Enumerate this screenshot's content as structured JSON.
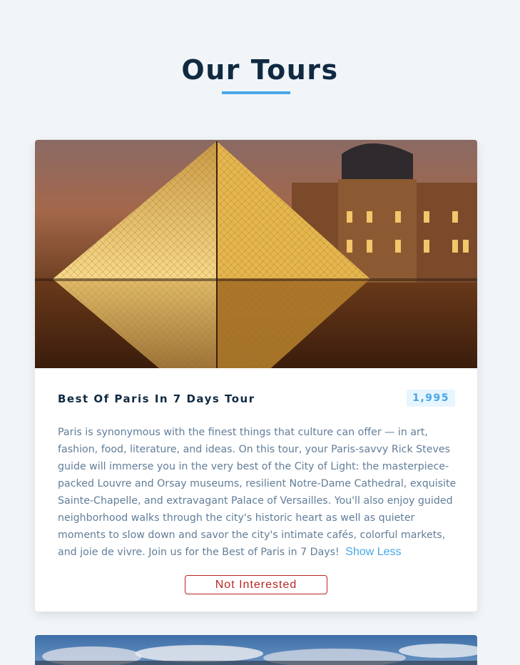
{
  "section": {
    "title": "Our Tours"
  },
  "tours": [
    {
      "name": "Best Of Paris In 7 Days Tour",
      "price": "1,995",
      "info": "Paris is synonymous with the finest things that culture can offer — in art, fashion, food, literature, and ideas. On this tour, your Paris-savvy Rick Steves guide will immerse you in the very best of the City of Light: the masterpiece-packed Louvre and Orsay museums, resilient Notre-Dame Cathedral, exquisite Sainte-Chapelle, and extravagant Palace of Versailles. You'll also enjoy guided neighborhood walks through the city's historic heart as well as quieter moments to slow down and savor the city's intimate cafés, colorful markets, and joie de vivre. Join us for the Best of Paris in 7 Days!",
      "toggle_label": "Show Less",
      "delete_label": "Not Interested"
    }
  ],
  "colors": {
    "title": "#102a42",
    "accent": "#49a6e9",
    "price_bg": "#e7f5fe",
    "text": "#617d98",
    "danger": "#bb2525",
    "background": "#f1f5f8"
  }
}
